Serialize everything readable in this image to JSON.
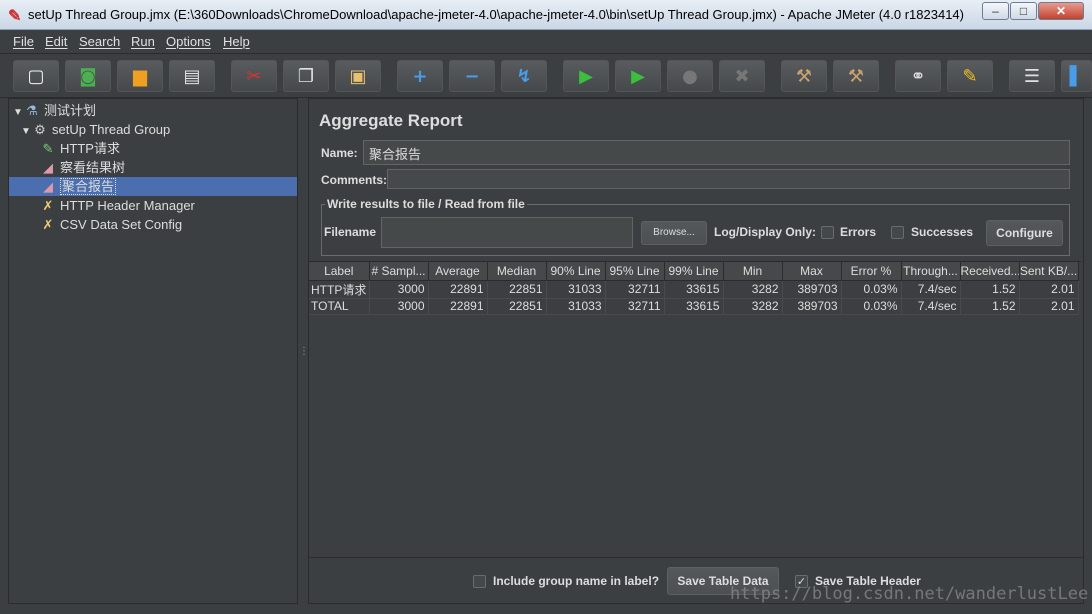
{
  "window": {
    "title": "setUp Thread Group.jmx (E:\\360Downloads\\ChromeDownload\\apache-jmeter-4.0\\apache-jmeter-4.0\\bin\\setUp Thread Group.jmx) - Apache JMeter (4.0 r1823414)",
    "minimize": "–",
    "maximize": "□",
    "close": "✕"
  },
  "menu": [
    "File",
    "Edit",
    "Search",
    "Run",
    "Options",
    "Help"
  ],
  "toolbar": [
    {
      "name": "new-icon",
      "glyph": "▢",
      "color": "#f2f2f2"
    },
    {
      "name": "templates-icon",
      "glyph": "◙",
      "color": "#4caf50"
    },
    {
      "name": "open-icon",
      "glyph": "▆",
      "color": "#f0a020"
    },
    {
      "name": "save-icon",
      "glyph": "▤",
      "color": "#e0e0e0"
    },
    {
      "name": "cut-icon",
      "glyph": "✂",
      "color": "#e03030"
    },
    {
      "name": "copy-icon",
      "glyph": "❐",
      "color": "#e0e0e0"
    },
    {
      "name": "paste-icon",
      "glyph": "▣",
      "color": "#e8c070"
    },
    {
      "name": "expand-icon",
      "glyph": "+",
      "color": "#4a9be8"
    },
    {
      "name": "collapse-icon",
      "glyph": "−",
      "color": "#4a9be8"
    },
    {
      "name": "toggle-icon",
      "glyph": "↯",
      "color": "#4a9be8"
    },
    {
      "name": "start-icon",
      "glyph": "▶",
      "color": "#3cbf3c"
    },
    {
      "name": "start-no-pauses-icon",
      "glyph": "▶",
      "color": "#3cbf3c"
    },
    {
      "name": "stop-icon",
      "glyph": "●",
      "color": "#777"
    },
    {
      "name": "shutdown-icon",
      "glyph": "✖",
      "color": "#777"
    },
    {
      "name": "clear-icon",
      "glyph": "⚒",
      "color": "#caa070"
    },
    {
      "name": "clear-all-icon",
      "glyph": "⚒",
      "color": "#caa070"
    },
    {
      "name": "search-icon",
      "glyph": "⚭",
      "color": "#e0e0e0"
    },
    {
      "name": "reset-search-icon",
      "glyph": "✎",
      "color": "#f0c020"
    },
    {
      "name": "function-helper-icon",
      "glyph": "☰",
      "color": "#e0e0e0"
    },
    {
      "name": "help-icon",
      "glyph": "▌",
      "color": "#4a9be8"
    }
  ],
  "tree": [
    {
      "label": "测试计划",
      "icon": "flask-icon",
      "glyph": "⚗",
      "level": 0,
      "expander": "▼"
    },
    {
      "label": "setUp Thread Group",
      "icon": "gear-icon",
      "glyph": "⚙",
      "level": 1,
      "expander": "▼"
    },
    {
      "label": "HTTP请求",
      "icon": "pipette-icon",
      "glyph": "✎",
      "level": 2,
      "expander": ""
    },
    {
      "label": "察看结果树",
      "icon": "chart-icon",
      "glyph": "◢",
      "level": 2,
      "expander": ""
    },
    {
      "label": "聚合报告",
      "icon": "chart-icon",
      "glyph": "◢",
      "level": 2,
      "expander": "",
      "selected": true
    },
    {
      "label": "HTTP Header Manager",
      "icon": "tools-icon",
      "glyph": "✗",
      "level": 2,
      "expander": ""
    },
    {
      "label": "CSV Data Set Config",
      "icon": "tools-icon",
      "glyph": "✗",
      "level": 2,
      "expander": ""
    }
  ],
  "panel": {
    "title": "Aggregate Report",
    "name_label": "Name:",
    "name_value": "聚合报告",
    "comments_label": "Comments:",
    "comments_value": "",
    "file_group_title": "Write results to file / Read from file",
    "filename_label": "Filename",
    "filename_value": "",
    "browse_label": "Browse...",
    "log_display_label": "Log/Display Only:",
    "errors_label": "Errors",
    "successes_label": "Successes",
    "configure_label": "Configure"
  },
  "table": {
    "headers": [
      "Label",
      "# Sampl...",
      "Average",
      "Median",
      "90% Line",
      "95% Line",
      "99% Line",
      "Min",
      "Max",
      "Error %",
      "Through...",
      "Received...",
      "Sent KB/..."
    ],
    "rows": [
      [
        "HTTP请求",
        "3000",
        "22891",
        "22851",
        "31033",
        "32711",
        "33615",
        "3282",
        "389703",
        "0.03%",
        "7.4/sec",
        "1.52",
        "2.01"
      ],
      [
        "TOTAL",
        "3000",
        "22891",
        "22851",
        "31033",
        "32711",
        "33615",
        "3282",
        "389703",
        "0.03%",
        "7.4/sec",
        "1.52",
        "2.01"
      ]
    ]
  },
  "footer": {
    "include_group_label": "Include group name in label?",
    "include_group_checked": false,
    "save_table_data_label": "Save Table Data",
    "save_table_header_label": "Save Table Header",
    "save_table_header_checked": true
  },
  "watermark": "https://blog.csdn.net/wanderlustLee"
}
